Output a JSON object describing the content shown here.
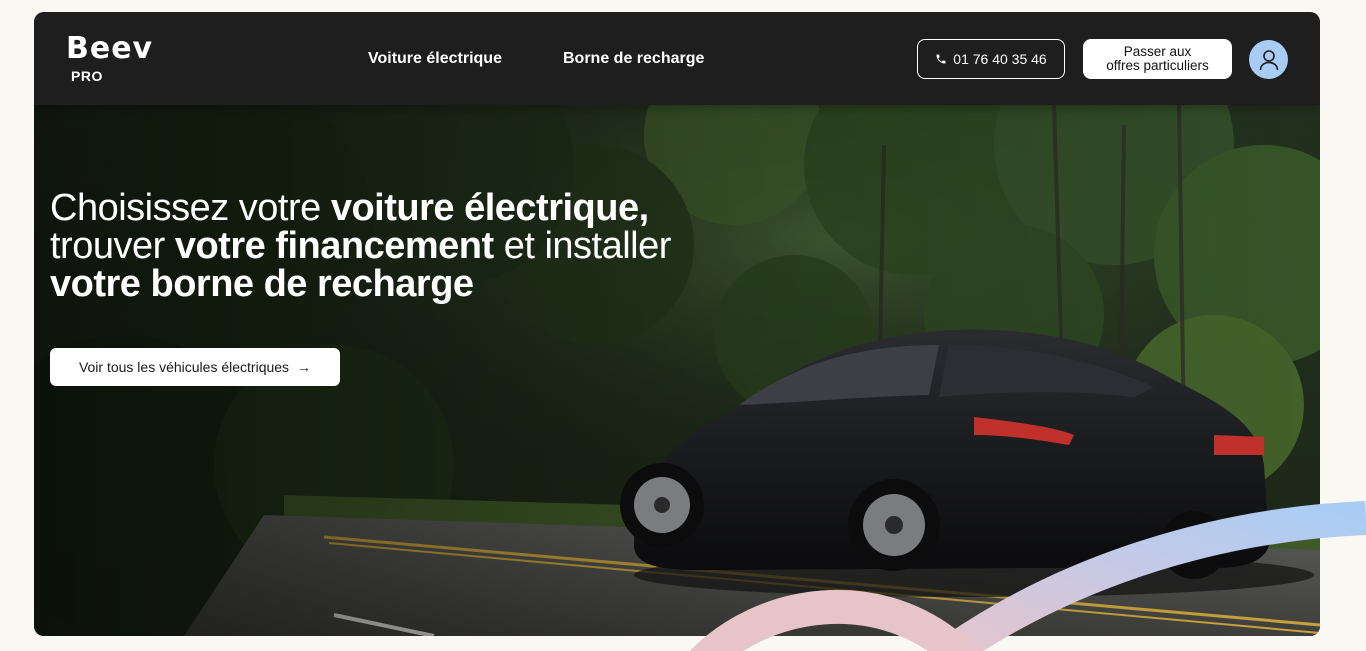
{
  "brand": {
    "name": "Beev",
    "sub": "PRO"
  },
  "nav": {
    "links": [
      "Voiture électrique",
      "Borne de recharge"
    ],
    "phone": "01 76 40 35 46",
    "switch_line1": "Passer aux",
    "switch_line2": "offres particuliers"
  },
  "hero": {
    "line1_a": "Choisissez votre ",
    "line1_b": "voiture électrique,",
    "line2_a": "trouver ",
    "line2_b": "votre financement",
    "line2_c": " et installer",
    "line3": "votre borne de recharge",
    "cta_label": "Voir tous les véhicules électriques",
    "cta_arrow": "→"
  },
  "colors": {
    "navbar": "#1e1e1e",
    "avatar": "#a9ccf4",
    "ribbon_blue": "#a9ccf4",
    "ribbon_pink": "#e8c4c9"
  },
  "icons": [
    "phone-icon",
    "user-icon",
    "arrow-right-icon"
  ]
}
